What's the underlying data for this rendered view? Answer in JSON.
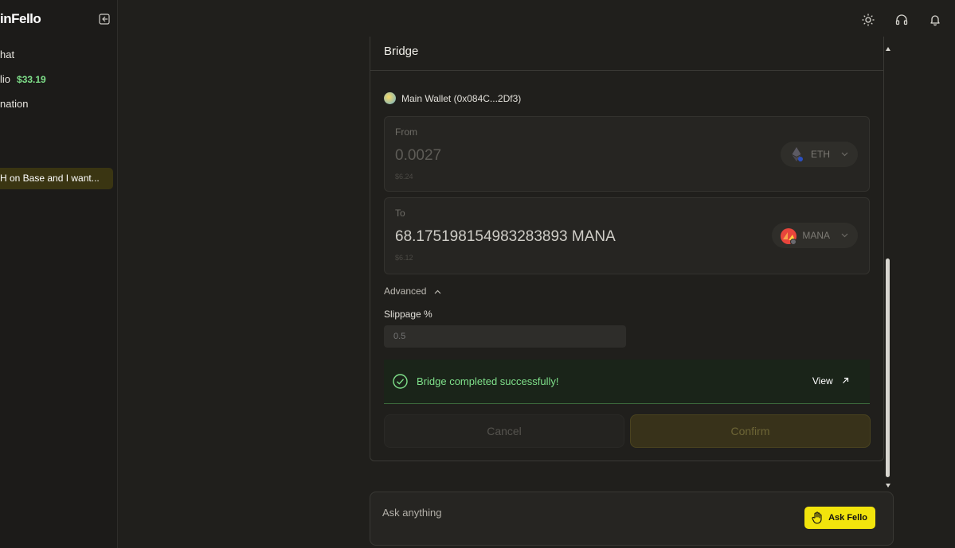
{
  "sidebar": {
    "brand": "inFello",
    "nav": {
      "chat": "hat",
      "portfolio_label": "lio",
      "portfolio_value": "$33.19",
      "third": "nation"
    },
    "history": [
      "H on Base and I want..."
    ]
  },
  "header": {
    "icons": [
      "sun-icon",
      "headset-icon",
      "bell-icon"
    ]
  },
  "bridge": {
    "title": "Bridge",
    "wallet": "Main Wallet (0x084C...2Df3)",
    "from": {
      "label": "From",
      "amount": "0.0027",
      "usd": "$6.24",
      "token": "ETH"
    },
    "to": {
      "label": "To",
      "amount": "68.175198154983283893 MANA",
      "usd": "$6.12",
      "token": "MANA"
    },
    "advanced_label": "Advanced",
    "slippage_label": "Slippage %",
    "slippage_placeholder": "0.5",
    "success_message": "Bridge completed successfully!",
    "view_label": "View",
    "cancel_label": "Cancel",
    "confirm_label": "Confirm"
  },
  "chat": {
    "placeholder": "Ask anything",
    "ask_button": "Ask Fello"
  },
  "colors": {
    "accent": "#f2e40c",
    "success": "#7fe08a",
    "background": "#201f1c"
  }
}
